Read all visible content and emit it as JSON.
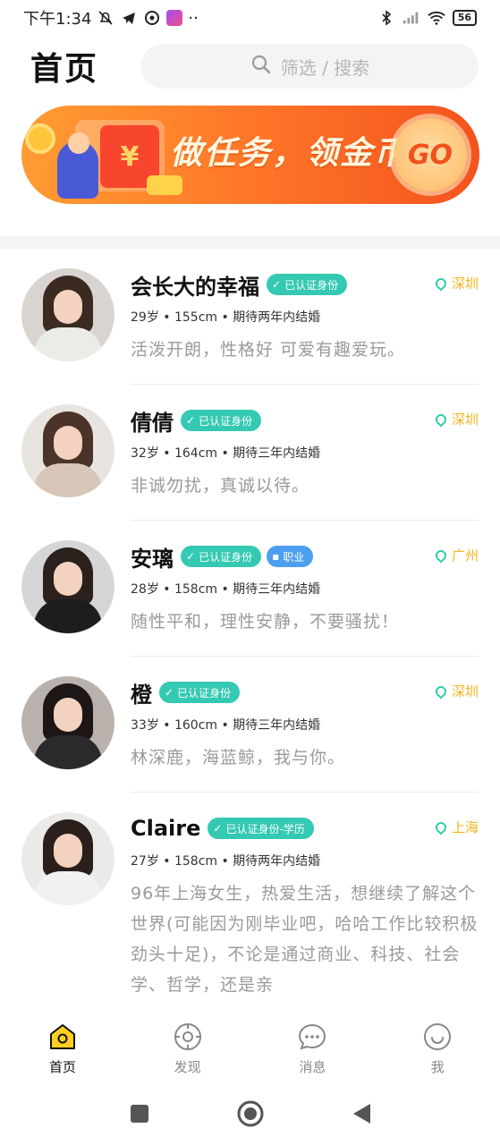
{
  "status_bar": {
    "time": "下午1:34",
    "battery": "56",
    "more": "··"
  },
  "header": {
    "title": "首页",
    "search_placeholder": "筛选 / 搜索"
  },
  "banner": {
    "text": "做任务，领金币",
    "go_label": "GO",
    "envelope_symbol": "¥"
  },
  "profiles": [
    {
      "name": "会长大的幸福",
      "badges": [
        "已认证身份"
      ],
      "location": "深圳",
      "meta": "29岁 • 155cm • 期待两年内结婚",
      "bio": "活泼开朗，性格好 可爱有趣爱玩。",
      "hair": "#3a2a22",
      "body": "#e9ede6"
    },
    {
      "name": "倩倩",
      "badges": [
        "已认证身份"
      ],
      "location": "深圳",
      "meta": "32岁 • 164cm • 期待三年内结婚",
      "bio": "非诚勿扰，真诚以待。",
      "hair": "#4a3328",
      "body": "#d8c7b8"
    },
    {
      "name": "安璃",
      "badges": [
        "已认证身份"
      ],
      "job_badge": "职业",
      "location": "广州",
      "meta": "28岁 • 158cm • 期待三年内结婚",
      "bio": "随性平和，理性安静，不要骚扰！",
      "hair": "#2b211c",
      "body": "#1d1d1f"
    },
    {
      "name": "橙",
      "badges": [
        "已认证身份"
      ],
      "location": "深圳",
      "meta": "33岁 • 160cm • 期待三年内结婚",
      "bio": "林深鹿，海蓝鲸，我与你。",
      "hair": "#1c1716",
      "body": "#2a2a2c"
    },
    {
      "name": "Claire",
      "badges": [
        "已认证身份-学历"
      ],
      "location": "上海",
      "meta": "27岁 • 158cm • 期待两年内结婚",
      "bio": "96年上海女生，热爱生活，想继续了解这个世界(可能因为刚毕业吧，哈哈工作比较积极劲头十足)，不论是通过商业、科技、社会学、哲学，还是亲",
      "hair": "#2a1f1b",
      "body": "#f1f1f1"
    }
  ],
  "bottom_nav": [
    {
      "label": "首页",
      "active": true
    },
    {
      "label": "发现",
      "active": false
    },
    {
      "label": "消息",
      "active": false
    },
    {
      "label": "我",
      "active": false
    }
  ],
  "colors": {
    "accent": "#f2b51b",
    "verified": "#34c9b2",
    "job": "#4c9ef0",
    "banner": "#ff7a2a"
  }
}
